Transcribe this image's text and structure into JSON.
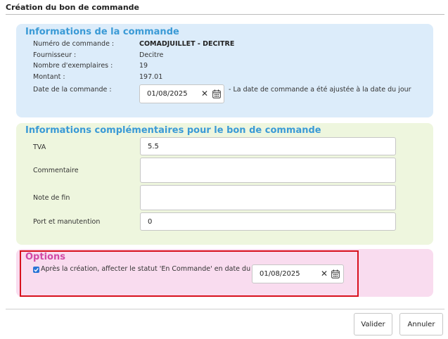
{
  "dialog": {
    "title": "Création du bon de commande"
  },
  "info": {
    "title": "Informations de la commande",
    "order_number_label": "Numéro de commande :",
    "order_number": "COMADJUILLET - DECITRE",
    "supplier_label": "Fournisseur :",
    "supplier": "Decitre",
    "copies_label": "Nombre d'exemplaires :",
    "copies": "19",
    "amount_label": "Montant :",
    "amount": "197.01",
    "date_label": "Date de la commande :",
    "date_value": "01/08/2025",
    "date_note": "- La date de commande a été ajustée à la date du jour"
  },
  "extra": {
    "title": "Informations complémentaires pour le bon de commande",
    "tva_label": "TVA",
    "tva_value": "5.5",
    "comment_label": "Commentaire",
    "comment_value": "",
    "endnote_label": "Note de fin",
    "endnote_value": "",
    "shipping_label": "Port et manutention",
    "shipping_value": "0"
  },
  "options": {
    "title": "Options",
    "checkbox_checked": true,
    "checkbox_label": "Après la création, affecter le statut 'En Commande' en date du",
    "date_value": "01/08/2025"
  },
  "buttons": {
    "validate": "Valider",
    "cancel": "Annuler"
  },
  "colors": {
    "info_bg": "#dcecfa",
    "extra_bg": "#eef6de",
    "options_bg": "#f9dcef",
    "section_title": "#3a9ad6",
    "options_title": "#d14aa6",
    "highlight": "#d8111d",
    "checkbox": "#2a74d5"
  },
  "icons": {
    "clear": "close-icon",
    "calendar": "calendar-icon"
  }
}
